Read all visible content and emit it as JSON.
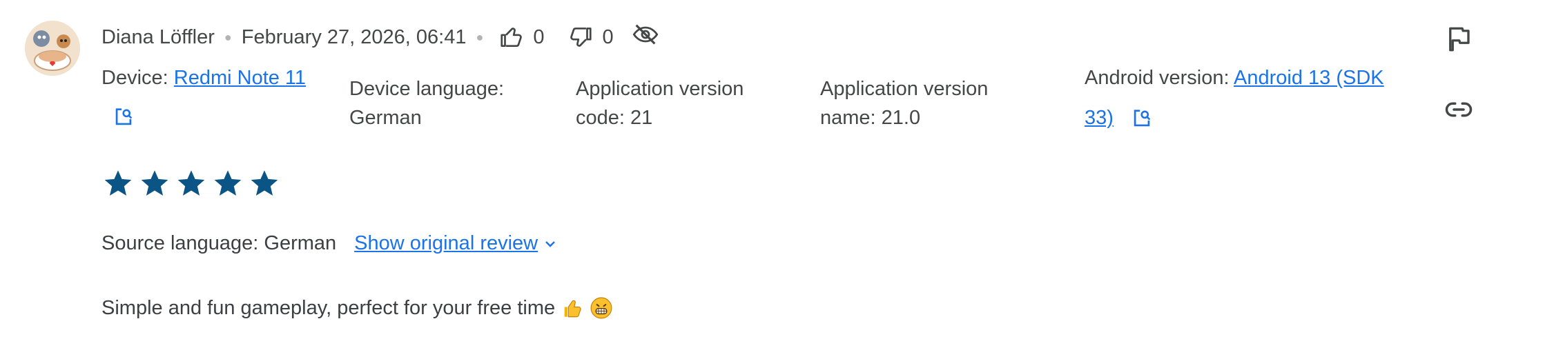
{
  "review": {
    "author": "Diana Löffler",
    "date": "February 27, 2026, 06:41",
    "thumbs_up_count": "0",
    "thumbs_down_count": "0",
    "rating": 5,
    "text": "Simple and fun gameplay, perfect for your free time"
  },
  "device": {
    "label": "Device:",
    "name": "Redmi Note 11",
    "language_label": "Device language:",
    "language_value": "German",
    "app_version_code_label": "Application version",
    "app_version_code_value": "code: 21",
    "app_version_name_label": "Application version",
    "app_version_name_value": "name: 21.0",
    "android_label": "Android version:",
    "android_value_line1": "Android 13 (SDK",
    "android_value_line2": "33)"
  },
  "translation": {
    "source_label": "Source language: German",
    "show_original": "Show original review"
  },
  "colors": {
    "star": "#0b5586",
    "link": "#1a73e8",
    "text": "#444746",
    "icon": "#444746"
  },
  "icons": [
    "thumb-up-icon",
    "thumb-down-icon",
    "visibility-off-icon",
    "open-in-new-icon",
    "flag-icon",
    "link-icon",
    "chevron-down-icon",
    "star-icon"
  ]
}
